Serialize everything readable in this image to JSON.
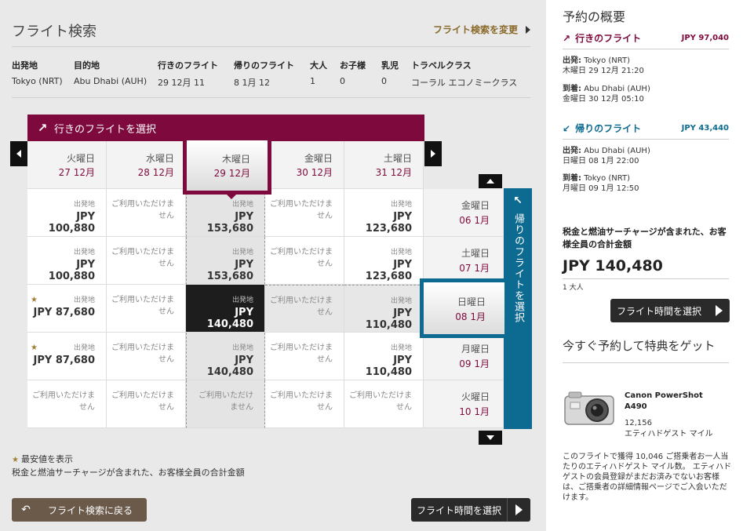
{
  "header": {
    "title": "フライト検索",
    "change_link": "フライト検索を変更"
  },
  "search_summary": {
    "labels": {
      "origin": "出発地",
      "destination": "目的地",
      "outbound": "行きのフライト",
      "return": "帰りのフライト",
      "adults": "大人",
      "children": "お子様",
      "infants": "乳児",
      "class": "トラベルクラス"
    },
    "values": {
      "origin": "Tokyo (NRT)",
      "destination": "Abu Dhabi (AUH)",
      "outbound": "29 12月 11",
      "return": "8 1月 12",
      "adults": "1",
      "children": "0",
      "infants": "0",
      "class": "コーラル エコノミークラス"
    }
  },
  "outbound_banner": "行きのフライトを選択",
  "return_banner": "帰りのフライトを選択",
  "outbound_days": [
    {
      "dow": "火曜日",
      "date": "27 12月"
    },
    {
      "dow": "水曜日",
      "date": "28 12月"
    },
    {
      "dow": "木曜日",
      "date": "29 12月"
    },
    {
      "dow": "金曜日",
      "date": "30 12月"
    },
    {
      "dow": "土曜日",
      "date": "31 12月"
    }
  ],
  "return_days": [
    {
      "dow": "金曜日",
      "date": "06 1月"
    },
    {
      "dow": "土曜日",
      "date": "07 1月"
    },
    {
      "dow": "日曜日",
      "date": "08 1月"
    },
    {
      "dow": "月曜日",
      "date": "09 1月"
    },
    {
      "dow": "火曜日",
      "date": "10 1月"
    }
  ],
  "grid_text": {
    "from": "出発地",
    "unavailable": "ご利用いただけません"
  },
  "fares": [
    [
      "JPY 100,880",
      null,
      "JPY 153,680",
      null,
      "JPY 123,680"
    ],
    [
      "JPY 100,880",
      null,
      "JPY 153,680",
      null,
      "JPY 123,680"
    ],
    [
      "JPY 87,680",
      null,
      "JPY 140,480",
      null,
      "JPY 110,480"
    ],
    [
      "JPY 87,680",
      null,
      "JPY 140,480",
      null,
      "JPY 110,480"
    ],
    [
      null,
      null,
      null,
      null,
      null
    ]
  ],
  "legend": {
    "star_text": "最安値を表示",
    "note": "税金と燃油サーチャージが含まれた、お客様全員の合計金額"
  },
  "buttons": {
    "back": "フライト検索に戻る",
    "select_time": "フライト時間を選択"
  },
  "sidebar": {
    "title": "予約の概要",
    "outbound": {
      "label": "行きのフライト",
      "price": "JPY 97,040",
      "dep_label": "出発:",
      "dep_place": "Tokyo (NRT)",
      "dep_time": "木曜日 29 12月 21:20",
      "arr_label": "到着:",
      "arr_place": "Abu Dhabi (AUH)",
      "arr_time": "金曜日 30 12月 05:10"
    },
    "return": {
      "label": "帰りのフライト",
      "price": "JPY 43,440",
      "dep_label": "出発:",
      "dep_place": "Abu Dhabi (AUH)",
      "dep_time": "日曜日 08 1月 22:00",
      "arr_label": "到着:",
      "arr_place": "Tokyo (NRT)",
      "arr_time": "月曜日 09 1月 12:50"
    },
    "total_label": "税金と燃油サーチャージが含まれた、お客様全員の合計金額",
    "total": "JPY 140,480",
    "pax": "1 大人",
    "select_button": "フライト時間を選択",
    "promo_title": "今すぐ予約して特典をゲット",
    "product_name": "Canon PowerShot A490",
    "product_miles": "12,156",
    "product_miles_unit": "エティハドゲスト マイル",
    "note": "このフライトで獲得 10,046 ご搭乗者お一人当たりのエティハドゲスト マイル数。 エティハド ゲストの会員登録がまだお済みでないお客様は、ご搭乗者の詳細情報ページでご入会いただけます。"
  },
  "colors": {
    "outbound_accent": "#7e0a3d",
    "return_accent": "#0d6a90",
    "gold_link": "#8a6a2a"
  }
}
